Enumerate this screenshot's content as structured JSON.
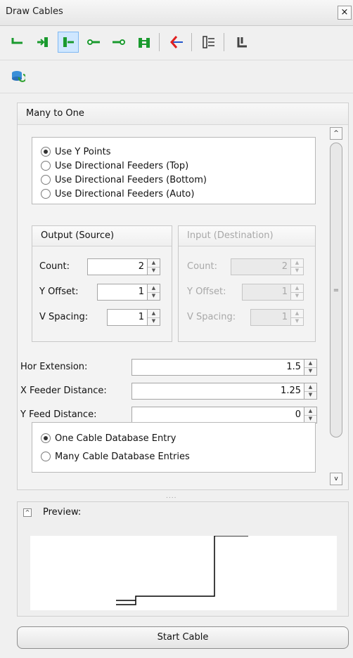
{
  "window": {
    "title": "Draw Cables",
    "close_glyph": "×"
  },
  "toolbar": {
    "icons": [
      "cable-step-icon",
      "cable-left-feed-icon",
      "cable-right-feed-icon",
      "cable-line-icon",
      "cable-arrow-icon",
      "cable-parallel-icon",
      "cable-split-icon",
      "cable-list-icon",
      "cable-corner-icon"
    ],
    "active_index": 2,
    "accent": "#1a9a2e"
  },
  "toolbar2": {
    "icon": "refresh-database-icon"
  },
  "panel": {
    "title": "Many to One",
    "mode_options": [
      {
        "label": "Use Y Points",
        "checked": true
      },
      {
        "label": "Use Directional Feeders (Top)",
        "checked": false
      },
      {
        "label": "Use Directional Feeders (Bottom)",
        "checked": false
      },
      {
        "label": "Use Directional Feeders (Auto)",
        "checked": false
      }
    ],
    "output": {
      "title": "Output (Source)",
      "count_label": "Count:",
      "count_value": "2",
      "yoffset_label": "Y Offset:",
      "yoffset_value": "1",
      "vspacing_label": "V Spacing:",
      "vspacing_value": "1"
    },
    "input": {
      "title": "Input (Destination)",
      "count_label": "Count:",
      "count_value": "2",
      "yoffset_label": "Y Offset:",
      "yoffset_value": "1",
      "vspacing_label": "V Spacing:",
      "vspacing_value": "1"
    },
    "hor_extension_label": "Hor Extension:",
    "hor_extension_value": "1.5",
    "x_feeder_label": "X Feeder Distance:",
    "x_feeder_value": "1.25",
    "y_feed_label": "Y Feed Distance:",
    "y_feed_value": "0",
    "db_options": [
      {
        "label": "One Cable Database Entry",
        "checked": true
      },
      {
        "label": "Many Cable Database Entries",
        "checked": false
      }
    ],
    "scroll": {
      "up": "^",
      "thumb": "=",
      "down": "v"
    }
  },
  "grip": "....",
  "preview": {
    "label": "Preview:",
    "collapse_glyph": "^"
  },
  "start_button": "Start Cable"
}
